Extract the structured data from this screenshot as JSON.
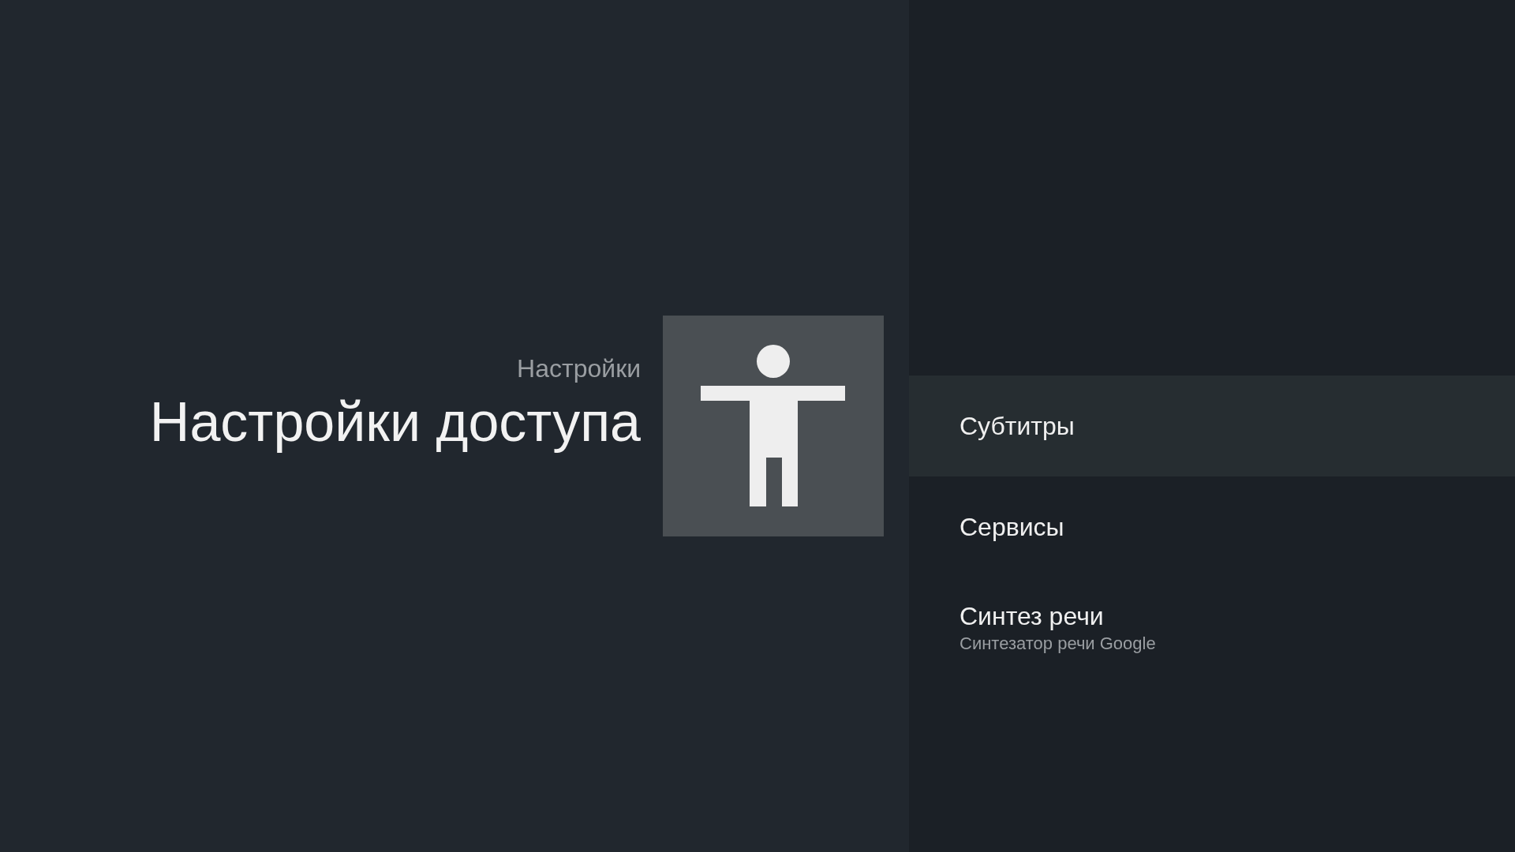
{
  "header": {
    "breadcrumb": "Настройки",
    "title": "Настройки доступа"
  },
  "items": [
    {
      "title": "Субтитры",
      "selected": true
    },
    {
      "title": "Сервисы",
      "selected": false
    },
    {
      "title": "Синтез речи",
      "summary": "Синтезатор речи Google",
      "selected": false
    }
  ]
}
